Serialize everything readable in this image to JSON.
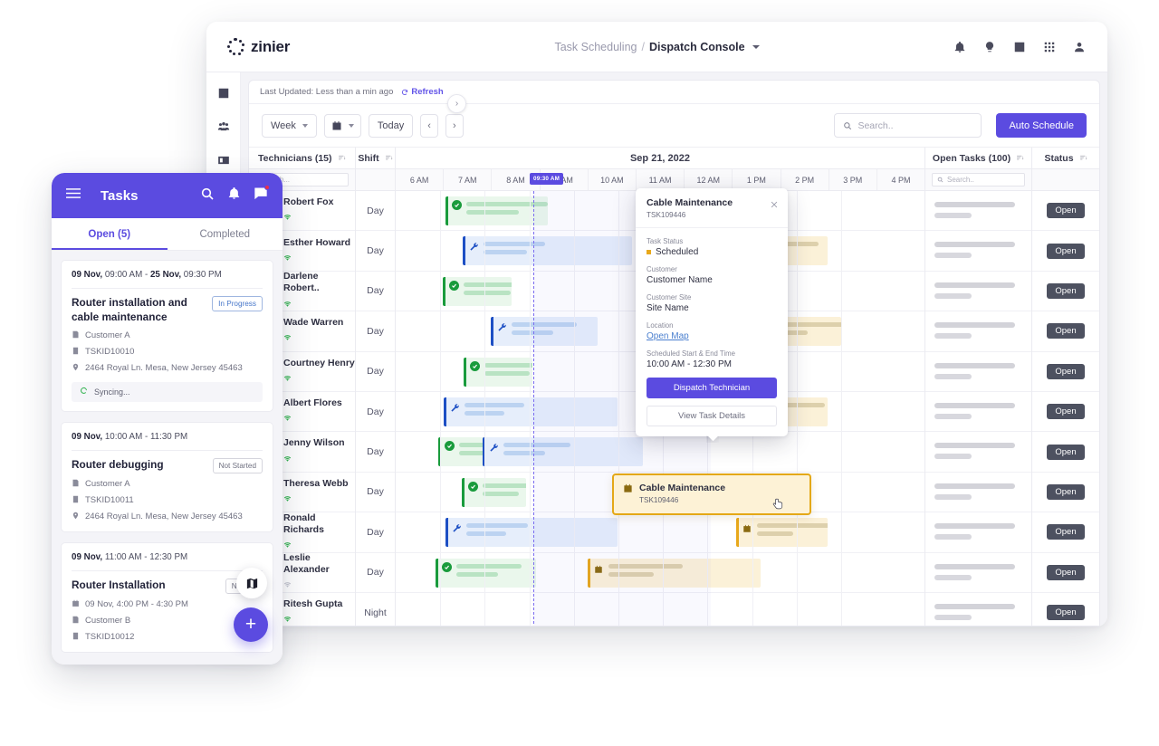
{
  "desktop": {
    "brand": {
      "name": "zinier",
      "logo_icon": "zinier-dots-logo"
    },
    "breadcrumb": {
      "parent": "Task Scheduling",
      "separator": "/",
      "current": "Dispatch Console"
    },
    "top_icons": [
      {
        "name": "notifications-icon",
        "glyph": "bell"
      },
      {
        "name": "ideas-icon",
        "glyph": "bulb"
      },
      {
        "name": "messages-icon",
        "glyph": "chat"
      },
      {
        "name": "apps-grid-icon",
        "glyph": "grid"
      },
      {
        "name": "user-account-icon",
        "glyph": "person"
      }
    ],
    "sidebar": {
      "toggle_glyph": "›",
      "items": [
        {
          "name": "sidebar-item-analytics",
          "icon": "bar-chart-icon"
        },
        {
          "name": "sidebar-item-teams",
          "icon": "people-icon"
        },
        {
          "name": "sidebar-item-contacts",
          "icon": "id-card-icon"
        }
      ]
    },
    "status_bar": {
      "last_updated": "Last Updated: Less than a min ago",
      "refresh_label": "Refresh",
      "refresh_icon": "refresh-icon"
    },
    "toolbar": {
      "view_select": "Week",
      "date_picker_icon": "calendar-icon",
      "today_label": "Today",
      "prev_label": "‹",
      "next_label": "›",
      "search_placeholder": "Search..",
      "search_icon": "search-icon",
      "auto_schedule_label": "Auto Schedule",
      "accent_color": "#5b4be0"
    },
    "grid": {
      "tech_header": "Technicians (15)",
      "shift_header": "Shift",
      "tech_search_placeholder": "Search...",
      "date_header": "Sep 21, 2022",
      "hours": [
        "6 AM",
        "7 AM",
        "8 AM",
        "9 AM",
        "10 AM",
        "11 AM",
        "12 AM",
        "1 PM",
        "2 PM",
        "3 PM",
        "4 PM"
      ],
      "now_marker": "09:30 AM",
      "open_header": "Open Tasks (100)",
      "status_header": "Status",
      "open_search_placeholder": "Search..",
      "open_status_label": "Open",
      "technicians": [
        {
          "name": "Robert Fox",
          "shift": "Day",
          "online": true
        },
        {
          "name": "Esther Howard",
          "shift": "Day",
          "online": true
        },
        {
          "name": "Darlene Robert..",
          "shift": "Day",
          "online": true
        },
        {
          "name": "Wade Warren",
          "shift": "Day",
          "online": true
        },
        {
          "name": "Courtney Henry",
          "shift": "Day",
          "online": true
        },
        {
          "name": "Albert Flores",
          "shift": "Day",
          "online": true
        },
        {
          "name": "Jenny Wilson",
          "shift": "Day",
          "online": true
        },
        {
          "name": "Theresa Webb",
          "shift": "Day",
          "online": true
        },
        {
          "name": "Ronald Richards",
          "shift": "Day",
          "online": true
        },
        {
          "name": "Leslie Alexander",
          "shift": "Day",
          "online": false
        },
        {
          "name": "Ritesh Gupta",
          "shift": "Night",
          "online": true
        }
      ]
    },
    "popover": {
      "title": "Cable Maintenance",
      "task_id": "TSK109446",
      "close_icon": "close-icon",
      "fields": [
        {
          "label": "Task Status",
          "value": "Scheduled",
          "status_color": "#e8a81b"
        },
        {
          "label": "Customer",
          "value": "Customer Name"
        },
        {
          "label": "Customer Site",
          "value": "Site Name"
        },
        {
          "label": "Location",
          "value": "Open Map",
          "is_link": true
        },
        {
          "label": "Scheduled Start & End Time",
          "value": "10:00 AM - 12:30 PM"
        }
      ],
      "primary_button": "Dispatch Technician",
      "secondary_button": "View Task Details"
    },
    "drag_card": {
      "title": "Cable Maintenance",
      "task_id": "TSK109446",
      "icon": "calendar-task-icon",
      "border_color": "#e4a817"
    }
  },
  "phone": {
    "header": {
      "menu_icon": "hamburger-menu-icon",
      "title": "Tasks",
      "search_icon": "search-icon",
      "bell_icon": "notifications-icon",
      "chat_icon": "messages-icon"
    },
    "tabs": [
      {
        "label": "Open (5)",
        "active": true
      },
      {
        "label": "Completed",
        "active": false
      }
    ],
    "cards": [
      {
        "date": "09 Nov, 09:00 AM - 25 Nov, 09:30 PM",
        "date_bold_1": "09 Nov,",
        "date_rest_1": " 09:00 AM - ",
        "date_bold_2": "25 Nov,",
        "date_rest_2": " 09:30 PM",
        "title": "Router installation and cable maintenance",
        "chip": "In Progress",
        "chip_style": "blue",
        "meta": [
          {
            "icon": "customer-icon",
            "text": "Customer A"
          },
          {
            "icon": "task-id-icon",
            "text": "TSKID10010"
          },
          {
            "icon": "location-pin-icon",
            "text": "2464 Royal Ln. Mesa, New Jersey 45463"
          }
        ],
        "sync_text": "Syncing...",
        "sync_icon": "sync-spinner-icon"
      },
      {
        "date_bold_1": "09 Nov,",
        "date_rest_1": " 10:00 AM - 11:30 PM",
        "date_bold_2": "",
        "date_rest_2": "",
        "title": "Router debugging",
        "chip": "Not Started",
        "chip_style": "gray",
        "meta": [
          {
            "icon": "customer-icon",
            "text": "Customer A"
          },
          {
            "icon": "task-id-icon",
            "text": "TSKID10011"
          },
          {
            "icon": "location-pin-icon",
            "text": "2464 Royal Ln. Mesa, New Jersey 45463"
          }
        ],
        "sync_text": "",
        "sync_icon": ""
      },
      {
        "date_bold_1": "09 Nov,",
        "date_rest_1": " 11:00 AM - 12:30 PM",
        "date_bold_2": "",
        "date_rest_2": "",
        "title": "Router Installation",
        "chip": "Not St..",
        "chip_style": "gray",
        "meta": [
          {
            "icon": "calendar-icon",
            "text": "09 Nov, 4:00 PM - 4:30 PM"
          },
          {
            "icon": "customer-icon",
            "text": "Customer B"
          },
          {
            "icon": "task-id-icon",
            "text": "TSKID10012"
          }
        ],
        "sync_text": "",
        "sync_icon": ""
      }
    ],
    "fab": {
      "name": "add-task-fab",
      "glyph": "+"
    },
    "map_fab": {
      "name": "map-fab",
      "icon": "map-icon"
    },
    "accent_color": "#5b4be0"
  }
}
